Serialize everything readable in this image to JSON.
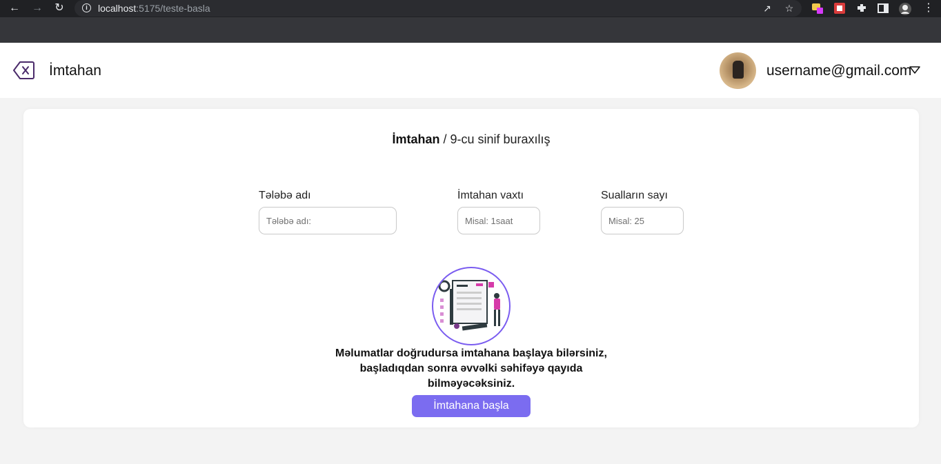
{
  "browser": {
    "url_host": "localhost",
    "url_path": ":5175/teste-basla"
  },
  "header": {
    "title": "İmtahan",
    "user_email": "username@gmail.com"
  },
  "card": {
    "breadcrumb_root": "İmtahan",
    "breadcrumb_separator": " / ",
    "breadcrumb_current": "9-cu sinif buraxılış",
    "fields": [
      {
        "label": "Tələbə adı",
        "placeholder": "Tələbə adı:",
        "value": ""
      },
      {
        "label": "İmtahan vaxtı",
        "placeholder": "Misal: 1saat",
        "value": ""
      },
      {
        "label": "Sualların sayı",
        "placeholder": "Misal: 25",
        "value": ""
      }
    ],
    "info_lines": [
      "Məlumatlar doğrudursa imtahana başlaya bilərsiniz,",
      "başladıqdan sonra əvvəlki səhifəyə qayıda",
      "bilməyəcəksiniz."
    ],
    "start_button_label": "İmtahana başla"
  },
  "colors": {
    "accent": "#7b6cf0",
    "back_icon": "#4a2a6a"
  }
}
